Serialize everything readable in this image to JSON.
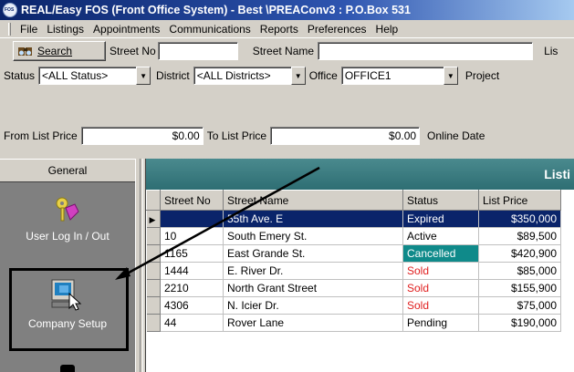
{
  "window": {
    "title": "REAL/Easy FOS (Front Office System) - Best \\PREAConv3 : P.O.Box 531"
  },
  "menu": [
    {
      "label": "File"
    },
    {
      "label": "Listings"
    },
    {
      "label": "Appointments"
    },
    {
      "label": "Communications"
    },
    {
      "label": "Reports"
    },
    {
      "label": "Preferences"
    },
    {
      "label": "Help"
    }
  ],
  "search": {
    "button_label": "Search",
    "street_no_label": "Street No",
    "street_no_value": "",
    "street_name_label": "Street Name",
    "street_name_value": "",
    "trailing_label": "Lis"
  },
  "filters": {
    "status_label": "Status",
    "status_value": "<ALL Status>",
    "district_label": "District",
    "district_value": "<ALL Districts>",
    "office_label": "Office",
    "office_value": "OFFICE1",
    "project_label": "Project"
  },
  "price": {
    "from_label": "From List Price",
    "from_value": "$0.00",
    "to_label": "To List Price",
    "to_value": "$0.00",
    "online_label": "Online Date"
  },
  "sidebar": {
    "header": "General",
    "items": [
      {
        "label": "User Log In / Out",
        "icon": "keys-icon"
      },
      {
        "label": "Company Setup",
        "icon": "company-setup-icon"
      }
    ]
  },
  "grid": {
    "title": "Listi",
    "columns": [
      "Street No",
      "Street Name",
      "Status",
      "List Price"
    ],
    "rows": [
      {
        "street_no": "",
        "street_name": "55th Ave. E",
        "status": "Expired",
        "price": "$350,000",
        "selected": true
      },
      {
        "street_no": "10",
        "street_name": "South Emery St.",
        "status": "Active",
        "price": "$89,500"
      },
      {
        "street_no": "1165",
        "street_name": "East Grande St.",
        "status": "Cancelled",
        "price": "$420,900"
      },
      {
        "street_no": "1444",
        "street_name": "E. River Dr.",
        "status": "Sold",
        "price": "$85,000"
      },
      {
        "street_no": "2210",
        "street_name": "North Grant Street",
        "status": "Sold",
        "price": "$155,900"
      },
      {
        "street_no": "4306",
        "street_name": "N. Icier Dr.",
        "status": "Sold",
        "price": "$75,000"
      },
      {
        "street_no": "44",
        "street_name": "Rover Lane",
        "status": "Pending",
        "price": "$190,000"
      }
    ]
  },
  "colors": {
    "title_bar": "#0a246a",
    "grid_header": "#2e6e73",
    "selection": "#0a246a",
    "sold": "#e02020",
    "cancelled": "#0f8a8a"
  }
}
